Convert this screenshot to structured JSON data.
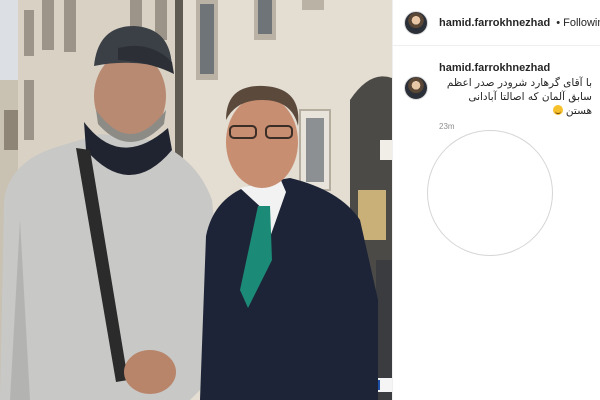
{
  "post": {
    "username": "hamid.farrokhnezhad",
    "follow_status": "Following",
    "separator": "•",
    "verified_icon": "verified-badge-icon",
    "accent_color": "#3897f0"
  },
  "caption": {
    "username": "hamid.farrokhnezhad",
    "text": "با آقای گرهارد شرودر صدر اعظم سابق آلمان که اصالتا آبادانی هستن",
    "emoji": "grinning-face",
    "timestamp": "23m"
  },
  "photo": {
    "description_icon": "photo-two-men-street"
  }
}
